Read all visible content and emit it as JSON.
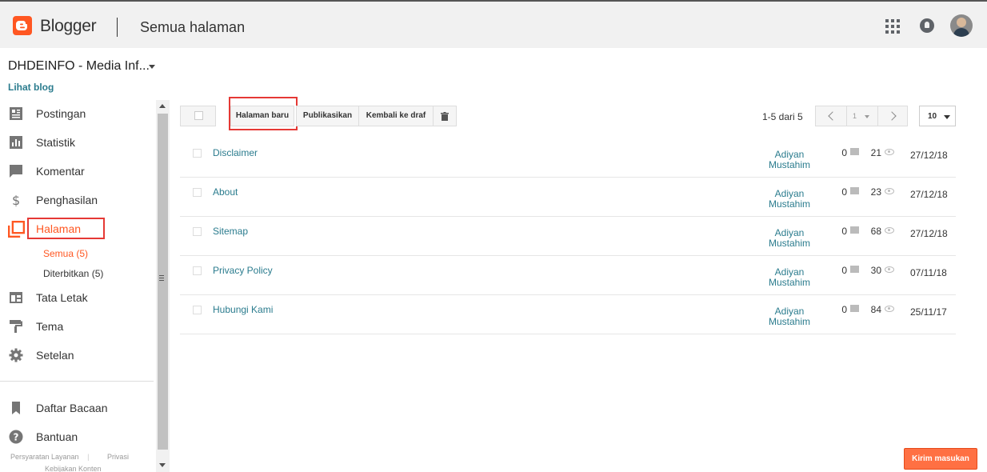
{
  "header": {
    "brand": "Blogger",
    "page_title": "Semua halaman"
  },
  "blog": {
    "name": "DHDEINFO - Media Inf...",
    "view_blog": "Lihat blog"
  },
  "sidebar": {
    "items": [
      {
        "label": "Postingan",
        "icon": "posts-icon"
      },
      {
        "label": "Statistik",
        "icon": "stats-icon"
      },
      {
        "label": "Komentar",
        "icon": "comment-icon"
      },
      {
        "label": "Penghasilan",
        "icon": "dollar-icon"
      },
      {
        "label": "Halaman",
        "icon": "pages-icon"
      },
      {
        "label": "Tata Letak",
        "icon": "layout-icon"
      },
      {
        "label": "Tema",
        "icon": "paint-roller-icon"
      },
      {
        "label": "Setelan",
        "icon": "gear-icon"
      }
    ],
    "sub_items": [
      {
        "label": "Semua (5)"
      },
      {
        "label": "Diterbitkan (5)"
      }
    ],
    "bottom_items": [
      {
        "label": "Daftar Bacaan",
        "icon": "bookmark-icon"
      },
      {
        "label": "Bantuan",
        "icon": "help-icon"
      }
    ],
    "footer": {
      "terms": "Persyaratan Layanan",
      "privacy": "Privasi",
      "content_policy": "Kebijakan Konten"
    }
  },
  "toolbar": {
    "new_page": "Halaman baru",
    "publish": "Publikasikan",
    "revert_draft": "Kembali ke draf",
    "range_text": "1-5 dari 5",
    "page": "1",
    "per_page": "10"
  },
  "pages": [
    {
      "title": "Disclaimer",
      "author": "Adiyan Mustahim",
      "comments": "0",
      "views": "21",
      "date": "27/12/18"
    },
    {
      "title": "About",
      "author": "Adiyan Mustahim",
      "comments": "0",
      "views": "23",
      "date": "27/12/18"
    },
    {
      "title": "Sitemap",
      "author": "Adiyan Mustahim",
      "comments": "0",
      "views": "68",
      "date": "27/12/18"
    },
    {
      "title": "Privacy Policy",
      "author": "Adiyan Mustahim",
      "comments": "0",
      "views": "30",
      "date": "07/11/18"
    },
    {
      "title": "Hubungi Kami",
      "author": "Adiyan Mustahim",
      "comments": "0",
      "views": "84",
      "date": "25/11/17"
    }
  ],
  "feedback": "Kirim masukan",
  "colors": {
    "brand": "#ff5722",
    "link": "#2b7c8e",
    "highlight": "#e53935"
  }
}
